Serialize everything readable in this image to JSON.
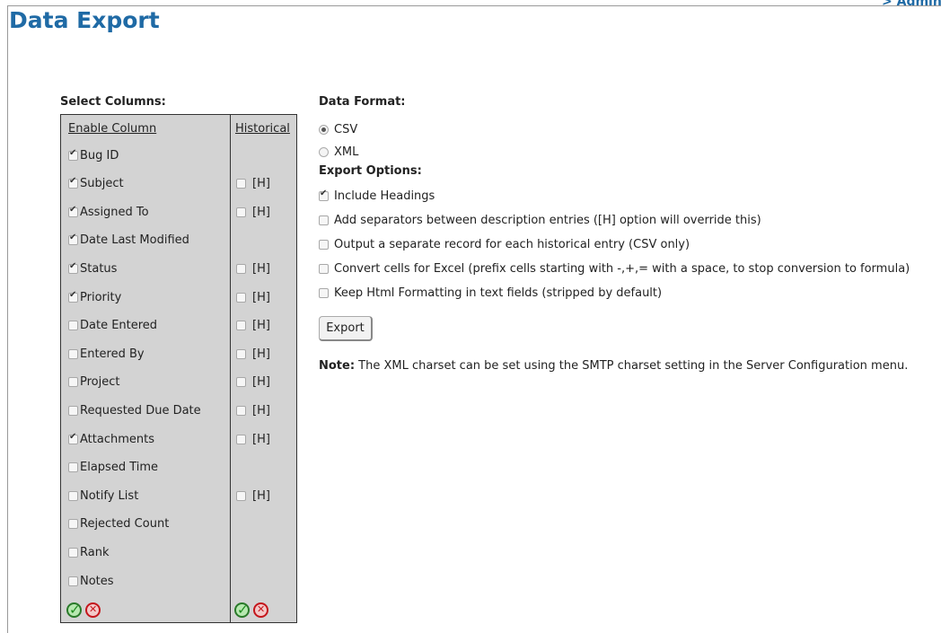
{
  "header": {
    "title": "Data Export",
    "admin_link": "> Admin I"
  },
  "columns": {
    "heading": "Select Columns:",
    "enable_header": "Enable Column",
    "historical_header": "Historical",
    "historical_tag": "[H]",
    "rows": [
      {
        "label": "Bug ID",
        "checked": true,
        "historical": false
      },
      {
        "label": "Subject",
        "checked": true,
        "historical": true
      },
      {
        "label": "Assigned To",
        "checked": true,
        "historical": true
      },
      {
        "label": "Date Last Modified",
        "checked": true,
        "historical": false
      },
      {
        "label": "Status",
        "checked": true,
        "historical": true
      },
      {
        "label": "Priority",
        "checked": true,
        "historical": true
      },
      {
        "label": "Date Entered",
        "checked": false,
        "historical": true
      },
      {
        "label": "Entered By",
        "checked": false,
        "historical": true
      },
      {
        "label": "Project",
        "checked": false,
        "historical": true
      },
      {
        "label": "Requested Due Date",
        "checked": false,
        "historical": true
      },
      {
        "label": "Attachments",
        "checked": true,
        "historical": true
      },
      {
        "label": "Elapsed Time",
        "checked": false,
        "historical": false
      },
      {
        "label": "Notify List",
        "checked": false,
        "historical": true
      },
      {
        "label": "Rejected Count",
        "checked": false,
        "historical": false
      },
      {
        "label": "Rank",
        "checked": false,
        "historical": false
      },
      {
        "label": "Notes",
        "checked": false,
        "historical": false
      }
    ]
  },
  "format": {
    "heading": "Data Format:",
    "options": [
      {
        "label": "CSV",
        "selected": true
      },
      {
        "label": "XML",
        "selected": false
      }
    ]
  },
  "export_options": {
    "heading": "Export Options:",
    "options": [
      {
        "label": "Include Headings",
        "checked": true
      },
      {
        "label": "Add separators between description entries ([H] option will override this)",
        "checked": false
      },
      {
        "label": "Output a separate record for each historical entry (CSV only)",
        "checked": false
      },
      {
        "label": "Convert cells for Excel (prefix cells starting with -,+,= with a space, to stop conversion to formula)",
        "checked": false
      },
      {
        "label": "Keep Html Formatting in text fields (stripped by default)",
        "checked": false
      }
    ]
  },
  "export_button": "Export",
  "note": {
    "label": "Note:",
    "text": " The XML charset can be set using the SMTP charset setting in the Server Configuration menu."
  },
  "colors": {
    "title": "#1f6aa5",
    "panel_bg": "#d3d3d3"
  }
}
